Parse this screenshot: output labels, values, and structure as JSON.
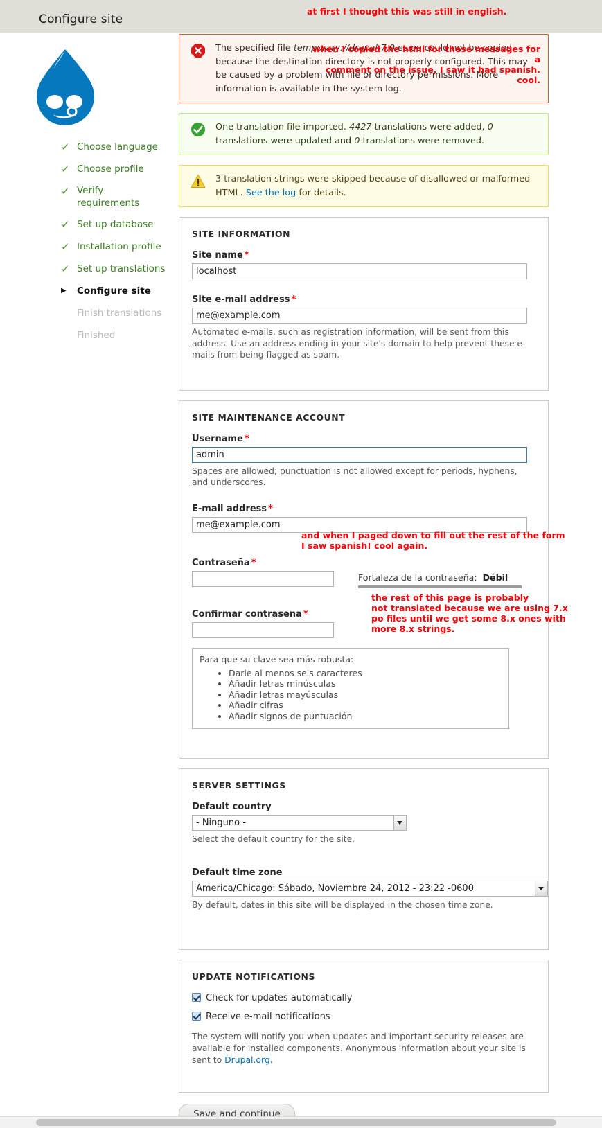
{
  "header": {
    "title": "Configure site"
  },
  "annotations": [
    {
      "id": "annot-language",
      "text": "at first I thought this was still in english."
    },
    {
      "id": "annot-html-copy",
      "text": "when I copied the html for these messages for a\ncomment on the issue, I saw it had spanish. cool."
    },
    {
      "id": "annot-paged-down",
      "text": "and when I paged down to fill out the rest of the form\nI saw spanish! cool again."
    },
    {
      "id": "annot-not-translated",
      "text": "the rest of this page is probably\nnot translated because we are using 7.x\npo files until we get some 8.x ones with\nmore 8.x strings."
    }
  ],
  "sidebar": {
    "logo_icon": "drupal-drop-logo",
    "steps": [
      {
        "label": "Choose language",
        "state": "done",
        "icon": "check-icon"
      },
      {
        "label": "Choose profile",
        "state": "done",
        "icon": "check-icon"
      },
      {
        "label": "Verify requirements",
        "state": "done",
        "icon": "check-icon"
      },
      {
        "label": "Set up database",
        "state": "done",
        "icon": "check-icon"
      },
      {
        "label": "Installation profile",
        "state": "done",
        "icon": "check-icon"
      },
      {
        "label": "Set up translations",
        "state": "done",
        "icon": "check-icon"
      },
      {
        "label": "Configure site",
        "state": "current",
        "icon": "arrow-right-icon"
      },
      {
        "label": "Finish translations",
        "state": "pending",
        "icon": "none"
      },
      {
        "label": "Finished",
        "state": "pending",
        "icon": "none"
      }
    ]
  },
  "messages": {
    "error": {
      "icon": "error-octagon-icon",
      "text_before": "The specified file ",
      "file": "temporary://drupal-7.0.es.po",
      "text_after": " could not be copied because the destination directory is not properly configured. This may be caused by a problem with file or directory permissions. More information is available in the system log."
    },
    "status": {
      "icon": "check-circle-icon",
      "part1": "One translation file imported. ",
      "count_added": "4427",
      "part2": " translations were added, ",
      "count_updated": "0",
      "part3": " translations were updated and ",
      "count_removed": "0",
      "part4": " translations were removed."
    },
    "warning": {
      "icon": "warning-triangle-icon",
      "part1": "3 translation strings were skipped because of disallowed or malformed HTML. ",
      "link": "See the log",
      "part2": " for details."
    }
  },
  "site_information": {
    "legend": "SITE INFORMATION",
    "site_name_label": "Site name",
    "site_name_value": "localhost",
    "site_email_label": "Site e-mail address",
    "site_email_value": "me@example.com",
    "site_email_desc": "Automated e-mails, such as registration information, will be sent from this address. Use an address ending in your site's domain to help prevent these e-mails from being flagged as spam.",
    "required_marker": "*"
  },
  "maintenance_account": {
    "legend": "SITE MAINTENANCE ACCOUNT",
    "username_label": "Username",
    "username_value": "admin",
    "username_desc": "Spaces are allowed; punctuation is not allowed except for periods, hyphens, and underscores.",
    "email_label": "E-mail address",
    "email_value": "me@example.com",
    "password_label": "Contraseña",
    "password_value": "",
    "confirm_password_label": "Confirmar contraseña",
    "confirm_password_value": "",
    "strength_label": "Fortaleza de la contraseña:",
    "strength_value": "Débil",
    "tips_title": "Para que su clave sea más robusta:",
    "tips": [
      "Darle al menos seis caracteres",
      "Añadir letras minúsculas",
      "Añadir letras mayúsculas",
      "Añadir cifras",
      "Añadir signos de puntuación"
    ]
  },
  "server_settings": {
    "legend": "SERVER SETTINGS",
    "country_label": "Default country",
    "country_value": "- Ninguno -",
    "country_desc": "Select the default country for the site.",
    "timezone_label": "Default time zone",
    "timezone_value": "America/Chicago: Sábado, Noviembre 24, 2012 - 23:22 -0600",
    "timezone_desc": "By default, dates in this site will be displayed in the chosen time zone."
  },
  "update_notifications": {
    "legend": "UPDATE NOTIFICATIONS",
    "check_updates_label": "Check for updates automatically",
    "check_updates_checked": true,
    "email_notifications_label": "Receive e-mail notifications",
    "email_notifications_checked": true,
    "desc_part1": "The system will notify you when updates and important security releases are available for installed components. Anonymous information about your site is sent to ",
    "desc_link": "Drupal.org",
    "desc_part2": "."
  },
  "actions": {
    "submit_label": "Save and continue"
  },
  "colors": {
    "error_border": "#ed541d",
    "status_border": "#bbee77",
    "warning_border": "#eedd55",
    "annotation": "#fb0007",
    "link": "#0071b3",
    "step_done": "#3a7d23"
  }
}
